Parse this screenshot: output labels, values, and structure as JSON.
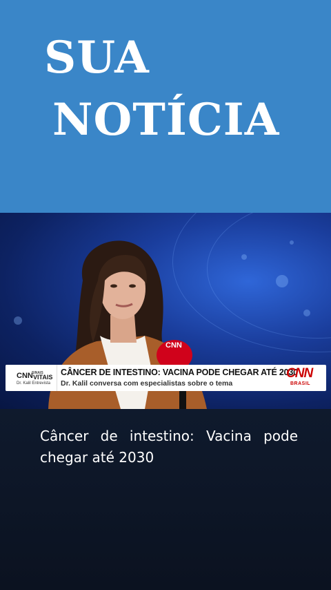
{
  "header": {
    "title_line1": "SUA",
    "title_line2": "NOTÍCIA",
    "background": "#3a86c8"
  },
  "video": {
    "lower_third": {
      "program_brand": "CNN",
      "program_tag": "SINAIS",
      "program_name": "VITAIS",
      "program_sub": "Dr. Kalil Entrevista",
      "headline": "CÂNCER DE INTESTINO: VACINA PODE CHEGAR ATÉ 2030",
      "subheadline": "Dr. Kalil conversa com especialistas sobre o tema",
      "logo_text": "CNN",
      "logo_sub": "BRASIL",
      "logo_color": "#cc0000"
    },
    "microphone_label": "CNN"
  },
  "caption": {
    "text": "Câncer de intestino: Vacina pode chegar até 2030"
  }
}
